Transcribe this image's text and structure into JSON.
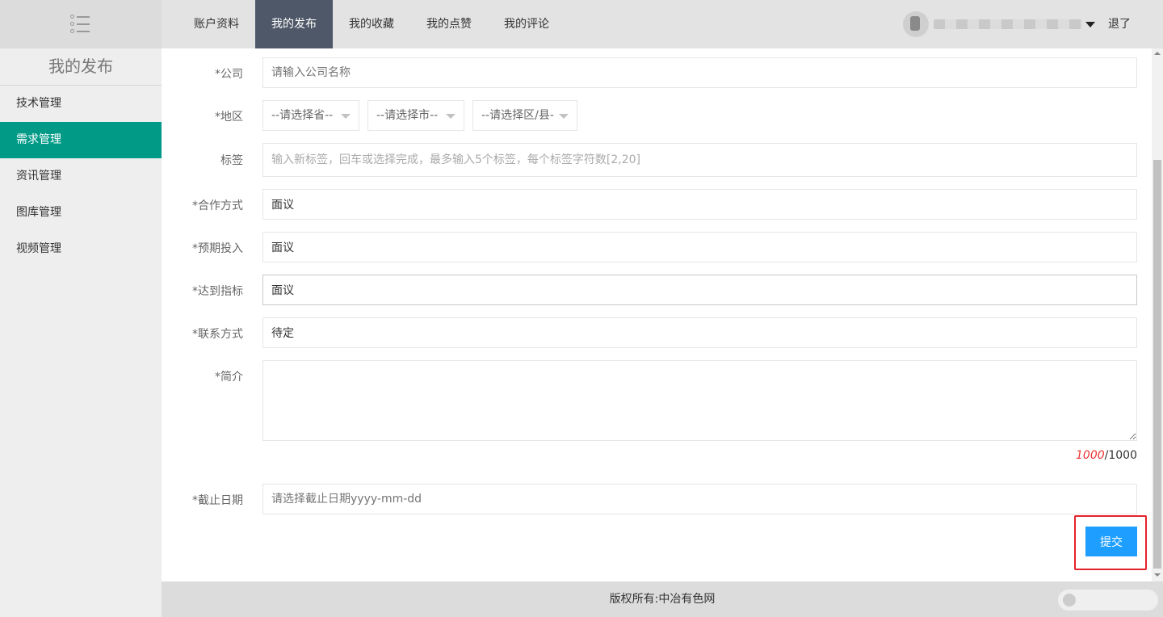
{
  "nav": {
    "items": [
      {
        "label": "账户资料"
      },
      {
        "label": "我的发布"
      },
      {
        "label": "我的收藏"
      },
      {
        "label": "我的点赞"
      },
      {
        "label": "我的评论"
      }
    ],
    "active_index": 1,
    "logout_label": "退了"
  },
  "sidebar": {
    "title": "我的发布",
    "items": [
      {
        "label": "技术管理"
      },
      {
        "label": "需求管理"
      },
      {
        "label": "资讯管理"
      },
      {
        "label": "图库管理"
      },
      {
        "label": "视频管理"
      }
    ],
    "active_index": 1
  },
  "form": {
    "company": {
      "label": "*公司",
      "placeholder": "请输入公司名称"
    },
    "region": {
      "label": "*地区",
      "province": "--请选择省--",
      "city": "--请选择市--",
      "district": "--请选择区/县-"
    },
    "tags": {
      "label": "标签",
      "placeholder": "输入新标签，回车或选择完成，最多输入5个标签，每个标签字符数[2,20]"
    },
    "cooperation": {
      "label": "*合作方式",
      "value": "面议"
    },
    "investment": {
      "label": "*预期投入",
      "value": "面议"
    },
    "target": {
      "label": "*达到指标",
      "value": "面议"
    },
    "contact": {
      "label": "*联系方式",
      "value": "待定"
    },
    "intro": {
      "label": "*简介",
      "value": ""
    },
    "counter": {
      "used": "1000",
      "max": "/1000"
    },
    "deadline": {
      "label": "*截止日期",
      "placeholder": "请选择截止日期yyyy-mm-dd"
    },
    "submit_label": "提交"
  },
  "footer": {
    "text": "版权所有:中冶有色网"
  },
  "colors": {
    "nav_active_bg": "#4f5868",
    "sidebar_active_bg": "#009a87",
    "submit_bg": "#1e9fff",
    "highlight_border": "#e6222b",
    "counter_used": "#e33333"
  }
}
